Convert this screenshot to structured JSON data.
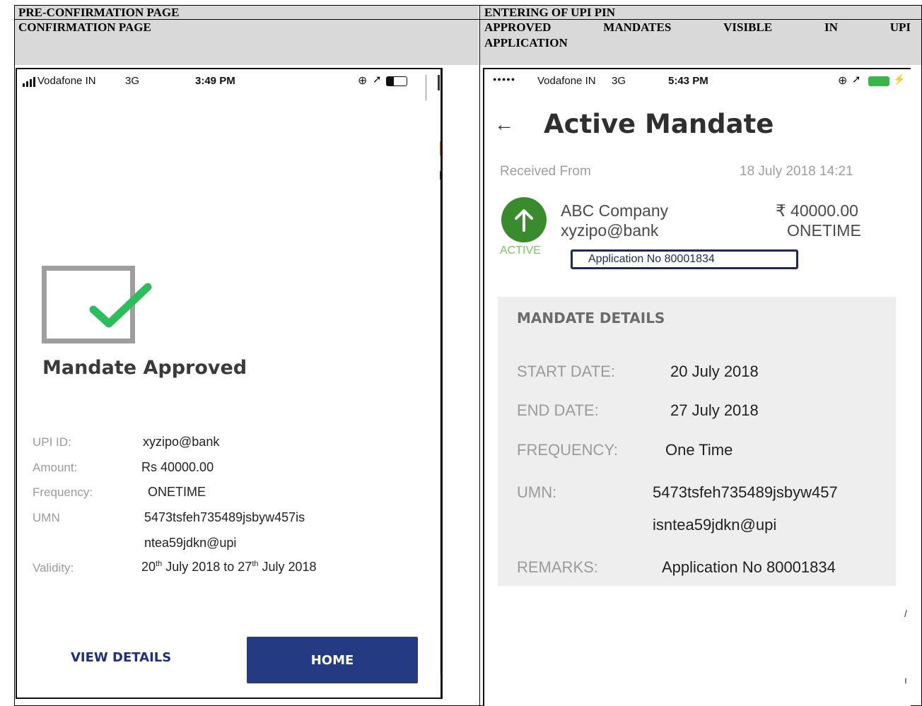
{
  "header": {
    "row1_left": "PRE-CONFIRMATION PAGE",
    "row1_right": "ENTERING OF UPI PIN",
    "row2_left": "CONFIRMATION PAGE",
    "row2_right_words": [
      "APPROVED",
      "MANDATES",
      "VISIBLE",
      "IN",
      "UPI"
    ],
    "row2_right_line2": "APPLICATION"
  },
  "left_phone": {
    "status": {
      "carrier": "Vodafone IN",
      "network": "3G",
      "time": "3:49 PM"
    },
    "title": "Mandate Approved",
    "icons": {
      "signal": "signal-bars-icon",
      "lock": "orientation-lock-icon",
      "location": "location-arrow-icon",
      "battery": "battery-icon",
      "check": "checkbox-checked-icon"
    },
    "check_color": "#2dbd5c",
    "fields": {
      "upi_label": "UPI ID:",
      "upi_value": "xyzipo@bank",
      "amount_label": "Amount:",
      "amount_value": "Rs 40000.00",
      "frequency_label": "Frequency:",
      "frequency_value": "ONETIME",
      "umn_label": "UMN",
      "umn_line1": "5473tsfeh735489jsbyw457is",
      "umn_line2": "ntea59jdkn@upi",
      "validity_label": "Validity:",
      "validity_start_day": "20",
      "validity_start_sup": "th",
      "validity_start_rest": " July 2018 to ",
      "validity_end_day": "27",
      "validity_end_sup": "th",
      "validity_end_rest": " July 2018"
    },
    "buttons": {
      "view_details": "VIEW DETAILS",
      "home": "HOME"
    },
    "accent": "#243a82"
  },
  "right_phone": {
    "status": {
      "dots": "●●●●●",
      "carrier": "Vodafone IN",
      "network": "3G",
      "time": "5:43 PM"
    },
    "back_arrow": "←",
    "title": "Active Mandate",
    "received_label": "Received From",
    "received_date": "18 July 2018 14:21",
    "payee": {
      "name": "ABC Company",
      "vpa": "xyzipo@bank",
      "amount": "₹ 40000.00",
      "type": "ONETIME",
      "status": "ACTIVE"
    },
    "application_box": "Application No 80001834",
    "details": {
      "heading": "MANDATE DETAILS",
      "start_label": "START DATE:",
      "start_value": "20 July 2018",
      "end_label": "END DATE:",
      "end_value": "27 July 2018",
      "frequency_label": "FREQUENCY:",
      "frequency_value": "One Time",
      "umn_label": "UMN:",
      "umn_line1": "5473tsfeh735489jsbyw457",
      "umn_line2": "isntea59jdkn@upi",
      "remarks_label": "REMARKS:",
      "remarks_value": "Application No 80001834"
    },
    "status_green": "#3a8a2e",
    "active_green": "#7cc35f"
  }
}
